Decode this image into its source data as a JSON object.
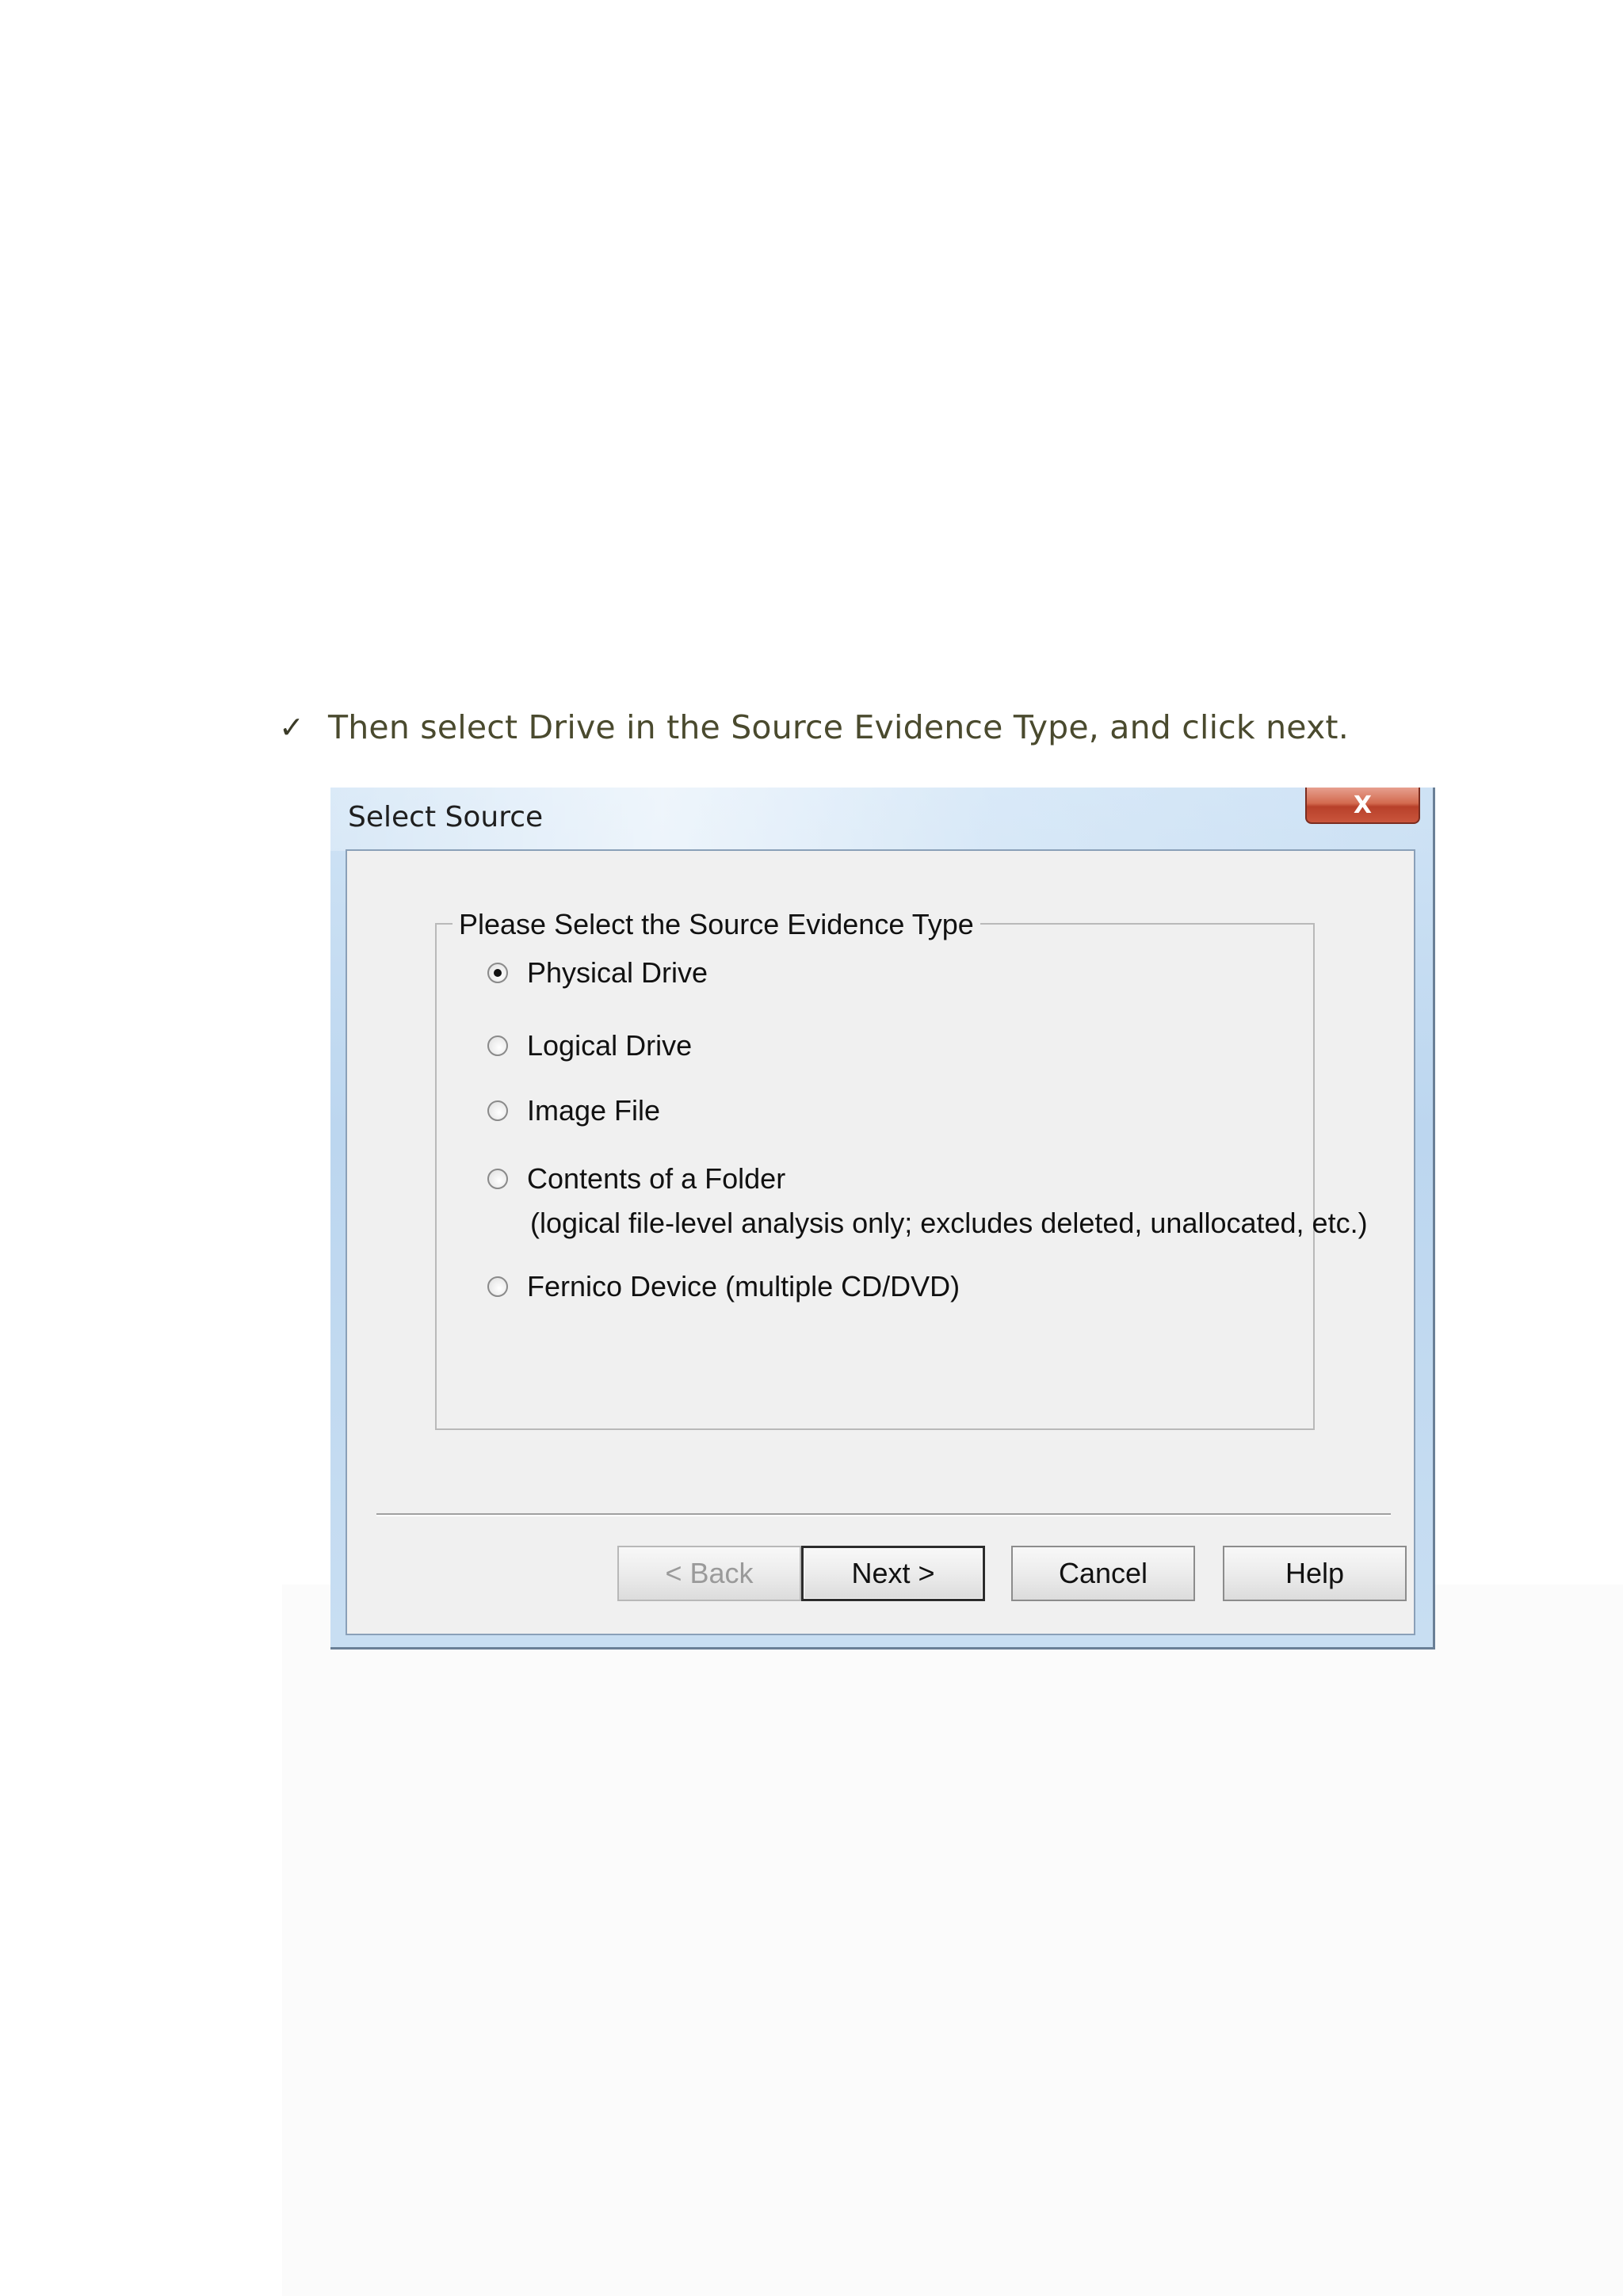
{
  "instruction": {
    "bullet_icon": "checkmark-icon",
    "bullet_glyph": "✓",
    "text": "Then select  Drive in the Source Evidence Type, and click next."
  },
  "dialog": {
    "title": "Select Source",
    "close_glyph": "X",
    "group": {
      "legend": "Please Select the Source Evidence Type",
      "options": [
        {
          "label": "Physical Drive",
          "checked": true
        },
        {
          "label": "Logical Drive",
          "checked": false
        },
        {
          "label": "Image File",
          "checked": false
        },
        {
          "label": "Contents of a Folder",
          "sublabel": "(logical file-level analysis only; excludes deleted, unallocated, etc.)",
          "checked": false
        },
        {
          "label": "Fernico Device (multiple CD/DVD)",
          "checked": false
        }
      ]
    },
    "buttons": {
      "back": "< Back",
      "next": "Next >",
      "cancel": "Cancel",
      "help": "Help"
    }
  }
}
